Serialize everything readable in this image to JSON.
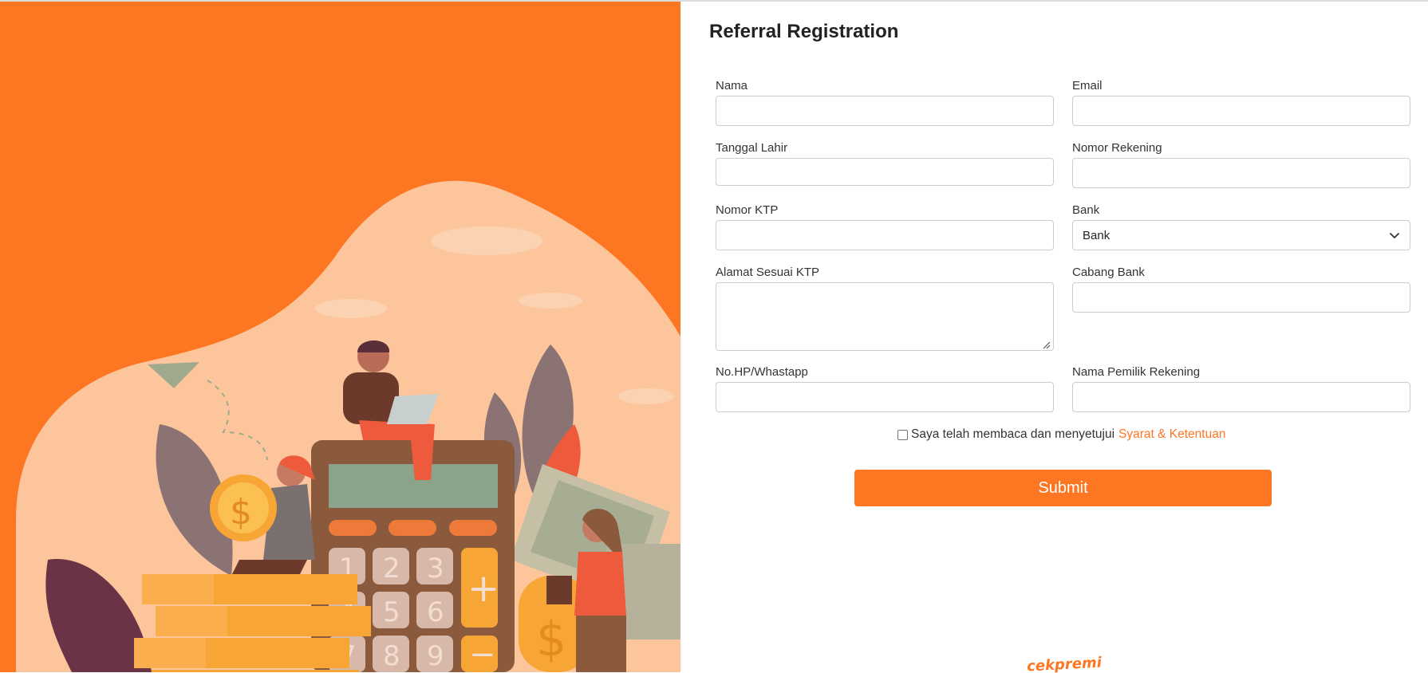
{
  "form": {
    "title": "Referral Registration",
    "fields": {
      "nama": {
        "label": "Nama",
        "value": ""
      },
      "email": {
        "label": "Email",
        "value": ""
      },
      "tanggal_lahir": {
        "label": "Tanggal Lahir",
        "value": ""
      },
      "nomor_rekening": {
        "label": "Nomor Rekening",
        "value": ""
      },
      "nomor_ktp": {
        "label": "Nomor KTP",
        "value": ""
      },
      "bank": {
        "label": "Bank",
        "selected": "Bank"
      },
      "alamat": {
        "label": "Alamat Sesuai KTP",
        "value": ""
      },
      "cabang_bank": {
        "label": "Cabang Bank",
        "value": ""
      },
      "no_hp": {
        "label": "No.HP/Whastapp",
        "value": ""
      },
      "nama_pemilik": {
        "label": "Nama Pemilik Rekening",
        "value": ""
      }
    },
    "terms": {
      "text": "Saya telah membaca dan menyetujui",
      "link": "Syarat & Ketentuan",
      "checked": false
    },
    "submit_label": "Submit"
  },
  "footer": {
    "logo_text": "cekpremi"
  },
  "colors": {
    "accent": "#fd7622",
    "illustration_blob": "#fdc59c",
    "text": "#222222"
  },
  "icons": {
    "bank_select": "chevron-down-icon",
    "textarea_resize": "resize-handle-icon"
  }
}
